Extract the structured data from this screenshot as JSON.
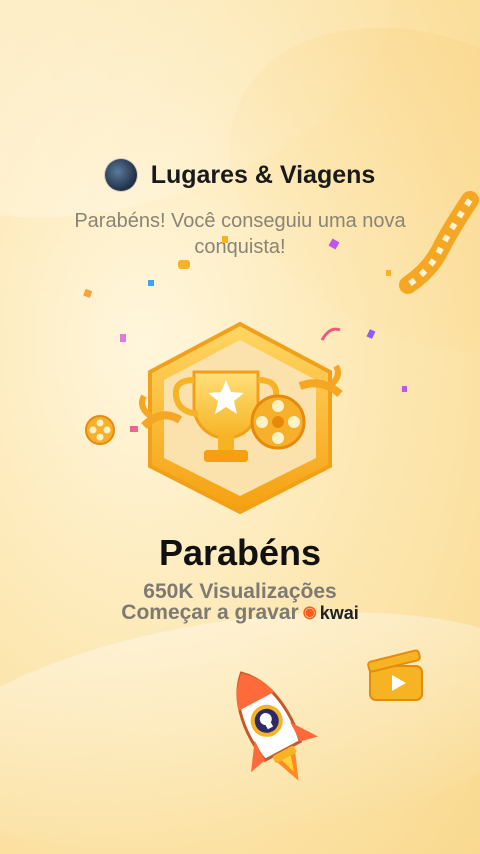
{
  "header": {
    "title": "Lugares & Viagens",
    "avatar_icon": "travel-avatar"
  },
  "subtitle": "Parabéns! Você conseguiu uma nova conquista!",
  "badge": {
    "icon": "trophy-badge-icon",
    "colors": {
      "primary": "#f6b323",
      "light": "#ffd766"
    }
  },
  "headline": "Parabéns",
  "stats": {
    "views": "650K Visualizações",
    "cta": "Começar a gravar",
    "brand": "kwai"
  },
  "colors": {
    "background": "#fde9b6",
    "accent": "#ff5a1f"
  }
}
